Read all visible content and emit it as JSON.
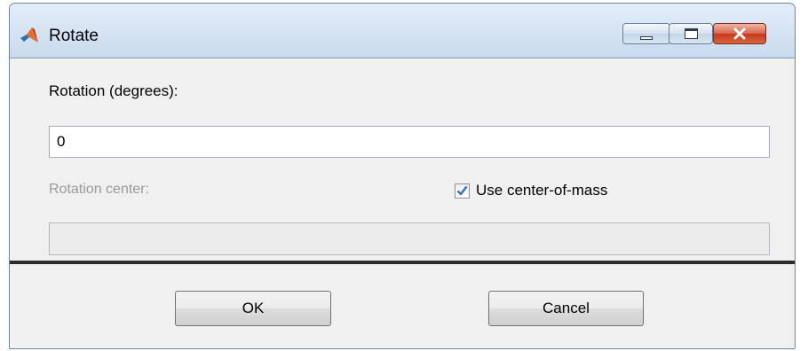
{
  "window": {
    "title": "Rotate",
    "controls": {
      "minimize": "minimize",
      "maximize": "maximize",
      "close": "close"
    }
  },
  "form": {
    "rotation_label": "Rotation (degrees):",
    "rotation_value": "0",
    "center_label": "Rotation center:",
    "center_value": "",
    "use_com_label": "Use center-of-mass",
    "use_com_checked": true
  },
  "buttons": {
    "ok": "OK",
    "cancel": "Cancel"
  },
  "icons": {
    "app": "matlab-logo-icon",
    "checkbox_check": "checkmark-icon"
  },
  "colors": {
    "accent": "#3a6ebf",
    "close": "#c7391c",
    "disabled_text": "#9a9a9a"
  }
}
